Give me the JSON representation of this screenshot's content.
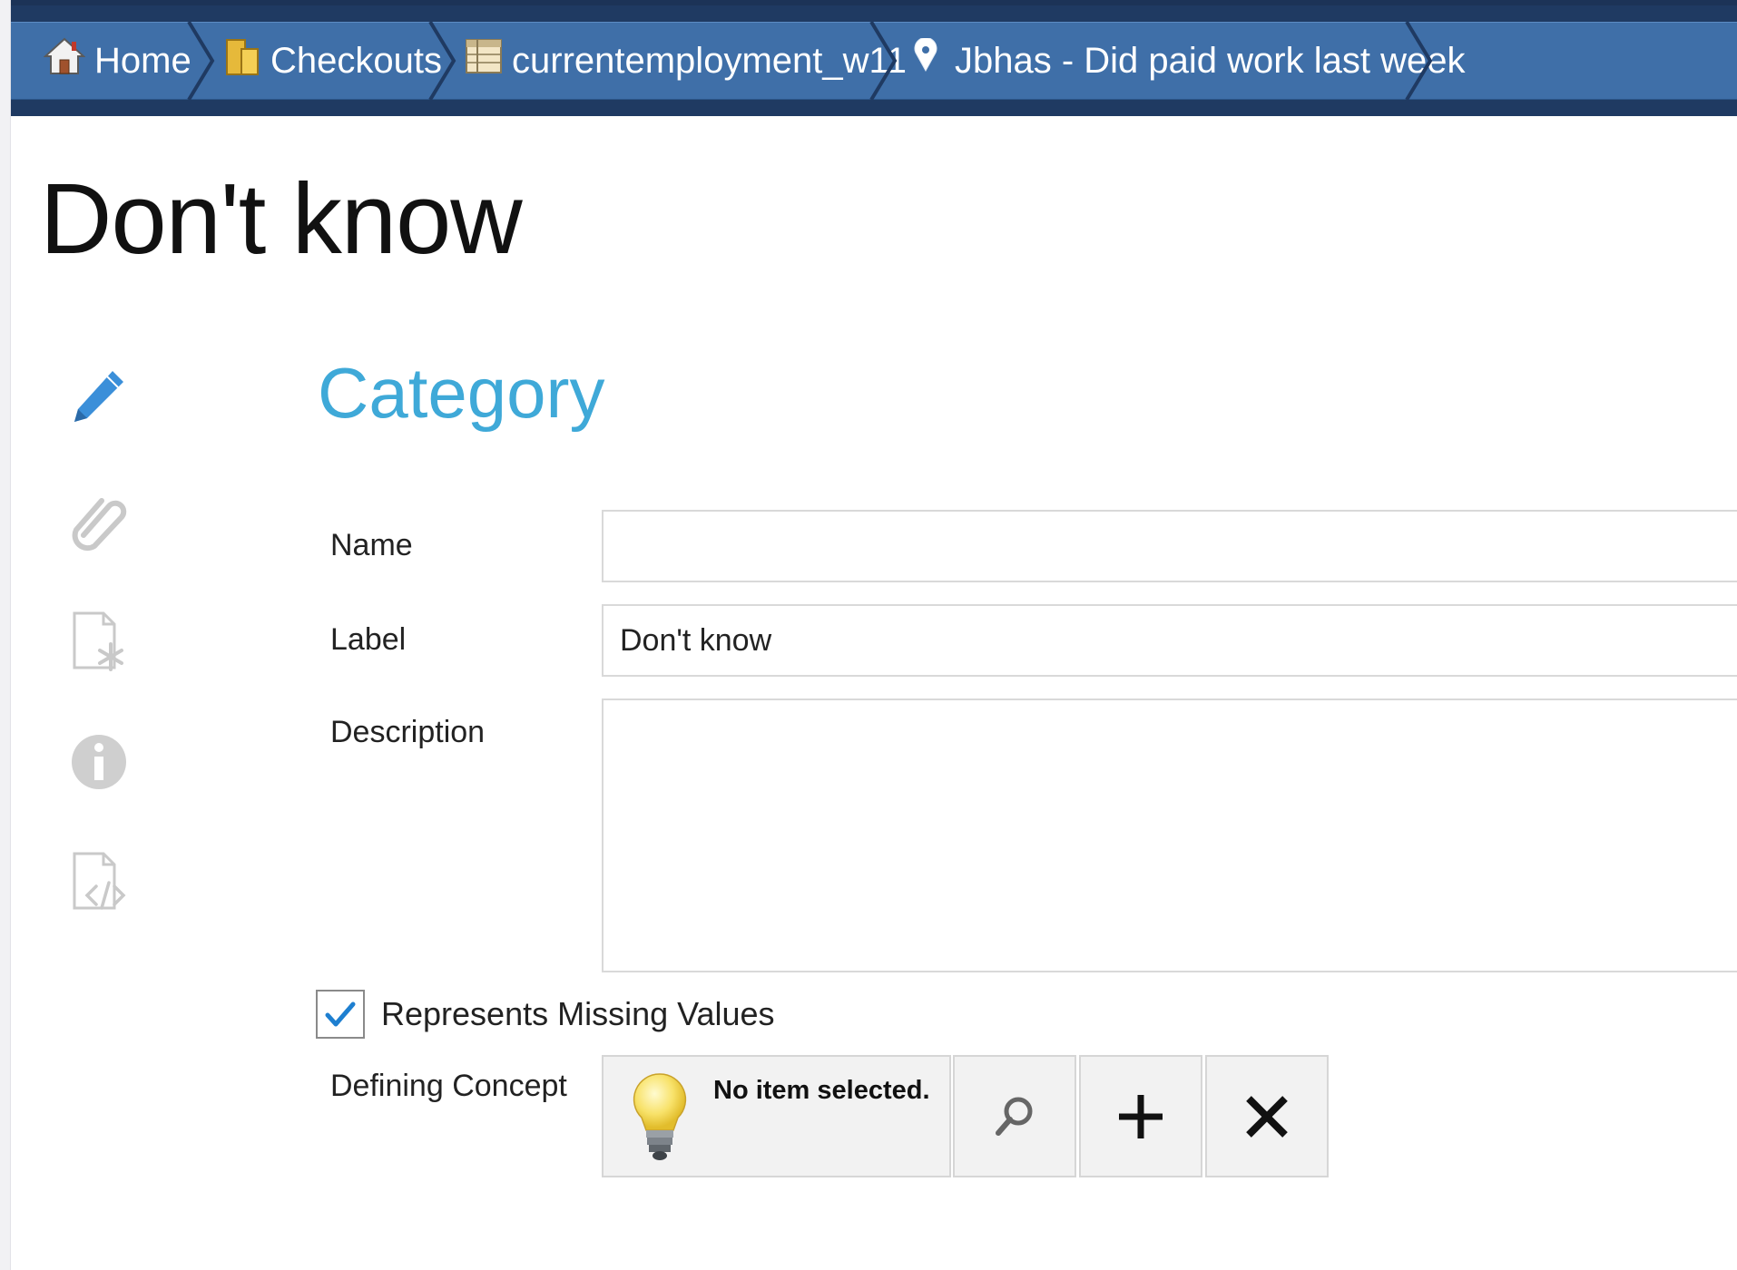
{
  "breadcrumbs": [
    {
      "label": "Home",
      "icon": "home-icon"
    },
    {
      "label": "Checkouts",
      "icon": "folder-icon"
    },
    {
      "label": "currentemployment_w11",
      "icon": "table-icon"
    },
    {
      "label": "Jbhas - Did paid work last week",
      "icon": "question-pin-icon"
    }
  ],
  "page_title": "Don't know",
  "side_rail": [
    "pencil-icon",
    "paperclip-icon",
    "document-asterisk-icon",
    "info-icon",
    "document-code-icon"
  ],
  "section_title": "Category",
  "form": {
    "name": {
      "label": "Name",
      "value": ""
    },
    "label": {
      "label": "Label",
      "value": "Don't know"
    },
    "description": {
      "label": "Description",
      "value": ""
    },
    "missing_values": {
      "label": "Represents Missing Values",
      "checked": true
    },
    "defining_concept": {
      "label": "Defining Concept",
      "value": "No item selected."
    }
  },
  "colors": {
    "crumb_bar": "#3f6fa8",
    "crumb_bar_dark": "#1f3a62",
    "accent": "#3fa9d8",
    "checkmark": "#1e7fd0"
  }
}
